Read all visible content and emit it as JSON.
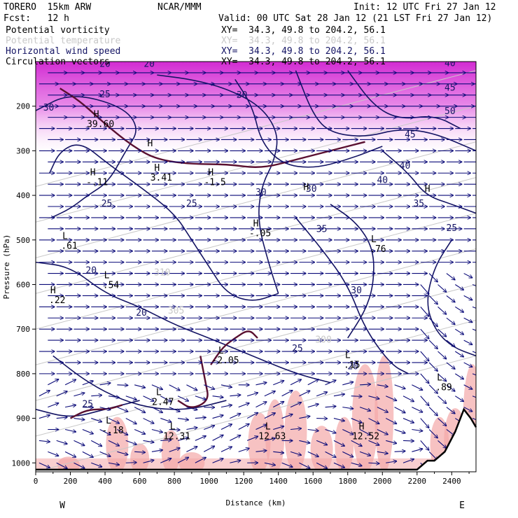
{
  "header": {
    "model": "TORERO  15km ARW",
    "center": "NCAR/MMM",
    "init": "Init: 12 UTC Fri 27 Jan 12",
    "fcst": "Fcst:   12 h",
    "valid": "Valid: 00 UTC Sat 28 Jan 12 (21 LST Fri 27 Jan 12)",
    "fields": [
      {
        "name": "Potential vorticity",
        "xy": "XY=  34.3, 49.8 to 204.2, 56.1",
        "color": "#000000"
      },
      {
        "name": "Potential temperature",
        "xy": "XY=  34.3, 49.8 to 204.2, 56.1",
        "color": "#c8c8c8"
      },
      {
        "name": "Horizontal wind speed",
        "xy": "XY=  34.3, 49.8 to 204.2, 56.1",
        "color": "#141464"
      },
      {
        "name": "Circulation vectors",
        "xy": "XY=  34.3, 49.8 to 204.2, 56.1",
        "color": "#000000"
      }
    ]
  },
  "chart_data": {
    "type": "cross-section",
    "xlabel": "Distance (km)",
    "ylabel": "Pressure (hPa)",
    "x_ticks": [
      0,
      200,
      400,
      600,
      800,
      1000,
      1200,
      1400,
      1600,
      1800,
      2000,
      2200,
      2400
    ],
    "y_ticks": [
      200,
      300,
      400,
      500,
      600,
      700,
      800,
      900,
      1000
    ],
    "xlim": [
      0,
      2540
    ],
    "ylim": [
      1020,
      100
    ],
    "end_labels": {
      "left": "W",
      "right": "E"
    },
    "colors": {
      "wind_speed": "#141464",
      "pv_shading": "#e040e0",
      "pv_low_shading": "#f4a8a8",
      "theta": "#c8c8c8",
      "vectors": "#0a0a78",
      "terrain": "#000000",
      "pv_contour": "#5a1030"
    },
    "wind_speed_labels": [
      {
        "x": 400,
        "p": 112,
        "text": "20"
      },
      {
        "x": 655,
        "p": 112,
        "text": "20"
      },
      {
        "x": 400,
        "p": 180,
        "text": "25"
      },
      {
        "x": 75,
        "p": 210,
        "text": "30"
      },
      {
        "x": 1190,
        "p": 182,
        "text": "30"
      },
      {
        "x": 2390,
        "p": 110,
        "text": "40"
      },
      {
        "x": 2390,
        "p": 165,
        "text": "45"
      },
      {
        "x": 2390,
        "p": 218,
        "text": "50"
      },
      {
        "x": 2160,
        "p": 270,
        "text": "45"
      },
      {
        "x": 2130,
        "p": 340,
        "text": "40"
      },
      {
        "x": 2000,
        "p": 372,
        "text": "40"
      },
      {
        "x": 1300,
        "p": 400,
        "text": "30"
      },
      {
        "x": 1590,
        "p": 392,
        "text": "30"
      },
      {
        "x": 410,
        "p": 425,
        "text": "25"
      },
      {
        "x": 900,
        "p": 425,
        "text": "25"
      },
      {
        "x": 1650,
        "p": 482,
        "text": "35"
      },
      {
        "x": 2210,
        "p": 425,
        "text": "35"
      },
      {
        "x": 2400,
        "p": 480,
        "text": "25"
      },
      {
        "x": 320,
        "p": 575,
        "text": "20"
      },
      {
        "x": 1850,
        "p": 620,
        "text": "30"
      },
      {
        "x": 610,
        "p": 670,
        "text": "20"
      },
      {
        "x": 1510,
        "p": 750,
        "text": "25"
      },
      {
        "x": 1830,
        "p": 790,
        "text": "20"
      },
      {
        "x": 300,
        "p": 875,
        "text": "25"
      }
    ],
    "extrema": [
      {
        "x": 350,
        "p": 225,
        "type": "H",
        "value": "39.60"
      },
      {
        "x": 330,
        "p": 355,
        "type": "H",
        "value": "-.11"
      },
      {
        "x": 660,
        "p": 290,
        "type": "H",
        "value": ""
      },
      {
        "x": 700,
        "p": 345,
        "type": "H",
        "value": "3.41"
      },
      {
        "x": 1010,
        "p": 355,
        "type": "H",
        "value": "-1.5"
      },
      {
        "x": 1560,
        "p": 388,
        "type": "H",
        "value": ""
      },
      {
        "x": 1270,
        "p": 470,
        "type": "H",
        "value": "-.05"
      },
      {
        "x": 1950,
        "p": 505,
        "type": "L",
        "value": ".76"
      },
      {
        "x": 2260,
        "p": 392,
        "type": "H",
        "value": ""
      },
      {
        "x": 170,
        "p": 498,
        "type": "L",
        "value": ".61"
      },
      {
        "x": 410,
        "p": 586,
        "type": "L",
        "value": ".54"
      },
      {
        "x": 100,
        "p": 620,
        "type": "H",
        "value": ".22"
      },
      {
        "x": 1070,
        "p": 755,
        "type": "L",
        "value": "-2.05"
      },
      {
        "x": 1800,
        "p": 765,
        "type": "L",
        "value": ".15"
      },
      {
        "x": 710,
        "p": 848,
        "type": "L",
        "value": "2.47"
      },
      {
        "x": 420,
        "p": 912,
        "type": "L",
        "value": "-.18"
      },
      {
        "x": 790,
        "p": 925,
        "type": "L",
        "value": "12.31"
      },
      {
        "x": 1340,
        "p": 925,
        "type": "L",
        "value": "12.63"
      },
      {
        "x": 2330,
        "p": 815,
        "type": "L",
        "value": ".89"
      },
      {
        "x": 1880,
        "p": 925,
        "type": "H",
        "value": "12.52"
      }
    ],
    "theta_labels": [
      {
        "x": 730,
        "p": 580,
        "text": "310"
      },
      {
        "x": 810,
        "p": 665,
        "text": "305"
      },
      {
        "x": 1660,
        "p": 730,
        "text": "300"
      }
    ]
  }
}
